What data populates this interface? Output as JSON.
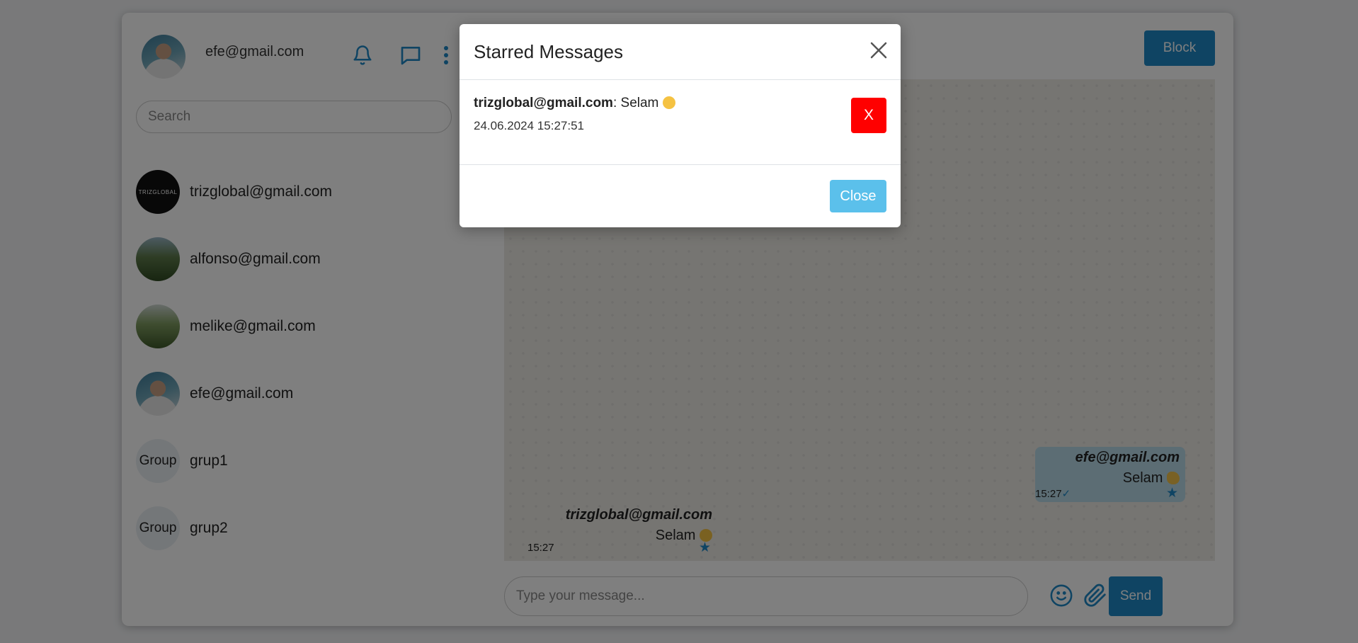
{
  "user": {
    "email": "efe@gmail.com"
  },
  "header": {
    "block_label": "Block"
  },
  "search": {
    "placeholder": "Search"
  },
  "contacts": [
    {
      "name": "trizglobal@gmail.com",
      "avatar_text": "TRIZGLOBAL"
    },
    {
      "name": "alfonso@gmail.com"
    },
    {
      "name": "melike@gmail.com"
    },
    {
      "name": "efe@gmail.com"
    },
    {
      "name": "grup1",
      "avatar_text": "Group"
    },
    {
      "name": "grup2",
      "avatar_text": "Group"
    }
  ],
  "messages": [
    {
      "sender": "efe@gmail.com",
      "text": "Selam",
      "time": "15:27",
      "starred": true
    },
    {
      "sender": "trizglobal@gmail.com",
      "text": "Selam",
      "time": "15:27",
      "starred": true
    }
  ],
  "composer": {
    "placeholder": "Type your message...",
    "send_label": "Send"
  },
  "modal": {
    "title": "Starred Messages",
    "items": [
      {
        "sender": "trizglobal@gmail.com",
        "separator": ": ",
        "text": "Selam",
        "date": "24.06.2024 15:27:51",
        "delete_label": "X"
      }
    ],
    "close_label": "Close"
  },
  "colors": {
    "accent": "#1e88c7",
    "danger": "#ff0000",
    "close": "#5bc0eb",
    "bubble": "#b9dbe9"
  },
  "icons": [
    "bell-icon",
    "chat-icon",
    "more-vertical-icon",
    "smile-icon",
    "paperclip-icon",
    "close-icon",
    "star-icon",
    "check-icon"
  ]
}
